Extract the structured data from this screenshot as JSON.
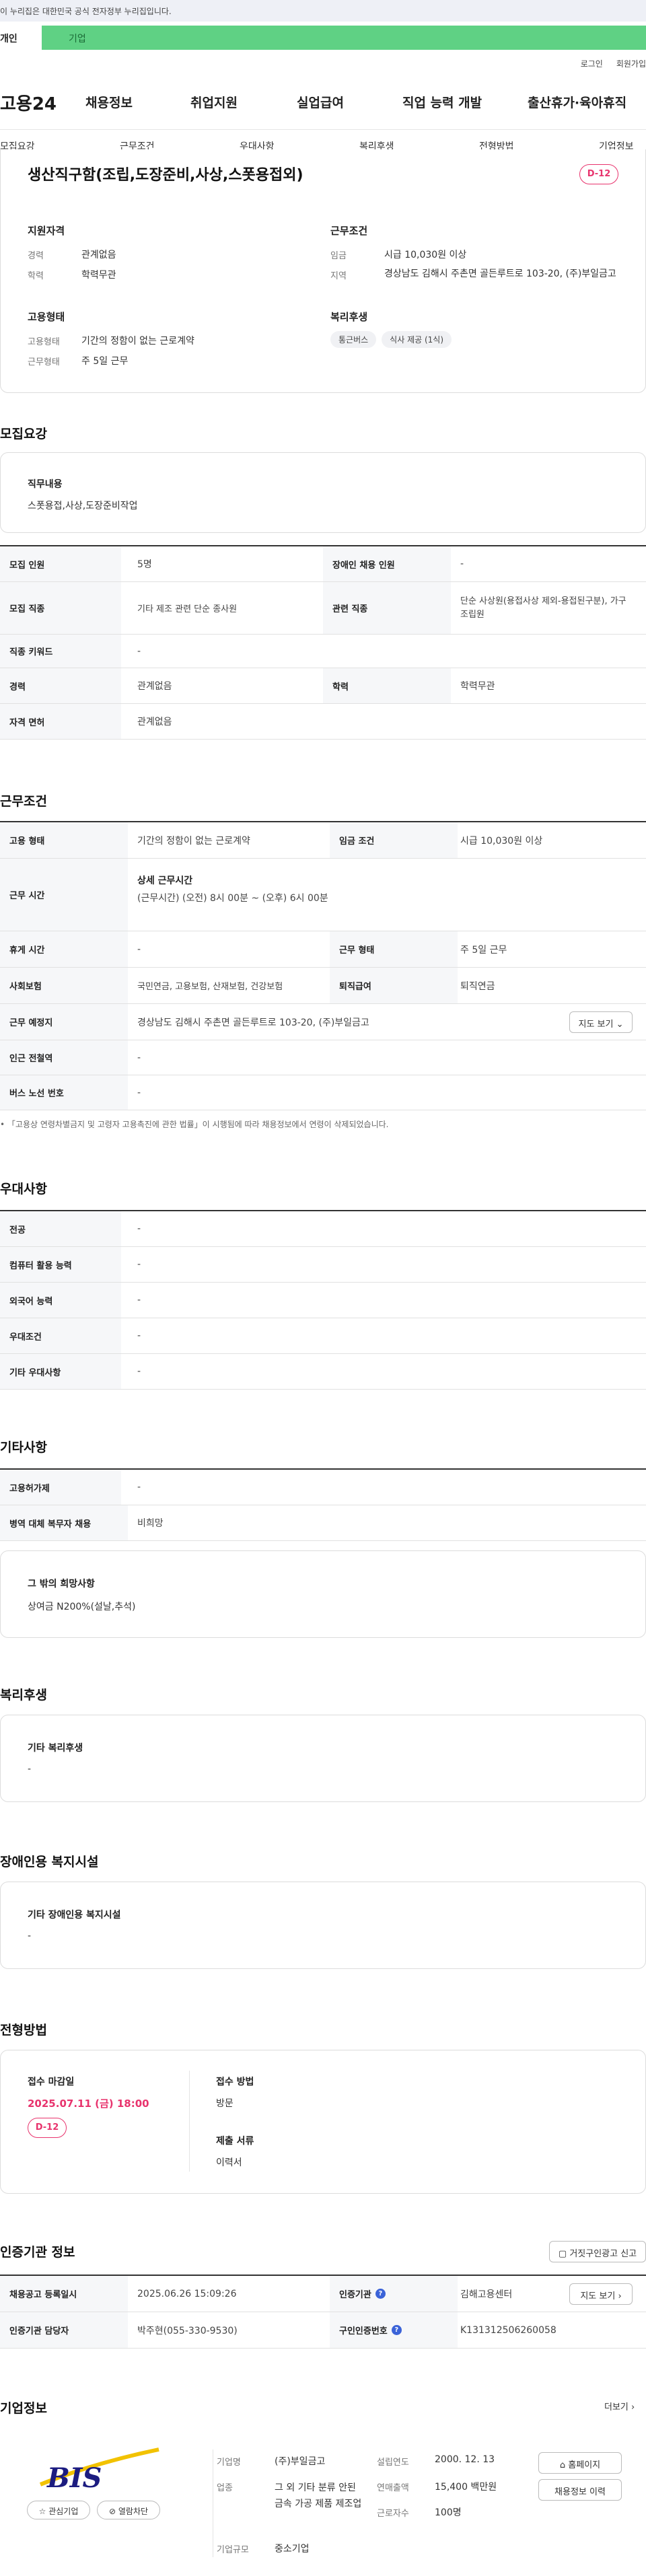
{
  "gov_banner": "이 누리집은 대한민국 공식 전자정부 누리집입니다.",
  "user_tabs": {
    "personal": "개인",
    "company": "기업"
  },
  "top_links": {
    "login": "로그인",
    "signup": "회원가입"
  },
  "logo": "고용24",
  "main_nav": [
    "채용정보",
    "취업지원",
    "실업급여",
    "직업 능력 개발",
    "출산휴가·육아휴직"
  ],
  "sub_nav": [
    "모집요강",
    "근무조건",
    "우대사항",
    "복리후생",
    "전형방법",
    "기업정보"
  ],
  "job": {
    "title": "생산직구함(조립,도장준비,사상,스폿용접외)",
    "dday": "D-12",
    "qualification_title": "지원자격",
    "qualification": [
      {
        "k": "경력",
        "v": "관계없음"
      },
      {
        "k": "학력",
        "v": "학력무관"
      }
    ],
    "conditions_title": "근무조건",
    "conditions": [
      {
        "k": "임금",
        "v": "시급 10,030원 이상"
      },
      {
        "k": "지역",
        "v": "경상남도 김해시 주촌면 골든루트로 103-20, (주)부일금고"
      }
    ],
    "employment_title": "고용형태",
    "employment": [
      {
        "k": "고용형태",
        "v": "기간의 정함이 없는 근로계약"
      },
      {
        "k": "근무형태",
        "v": "주 5일 근무"
      }
    ],
    "welfare_title": "복리후생",
    "welfare_chips": [
      "통근버스",
      "식사 제공 (1식)"
    ]
  },
  "recruit": {
    "title": "모집요강",
    "duty_label": "직무내용",
    "duty": "스폿용접,사상,도장준비작업",
    "rows": [
      {
        "k1": "모집 인원",
        "v1": "5명",
        "k2": "장애인 채용 인원",
        "v2": "-"
      },
      {
        "k1": "모집 직종",
        "v1": "기타 제조 관련 단순 종사원",
        "k2": "관련 직종",
        "v2": "단순 사상원(용접사상 제외-용접된구분), 가구 조립원"
      },
      {
        "k1": "직종 키워드",
        "v1": "-"
      },
      {
        "k1": "경력",
        "v1": "관계없음",
        "k2": "학력",
        "v2": "학력무관"
      },
      {
        "k1": "자격 면허",
        "v1": "관계없음"
      }
    ]
  },
  "work": {
    "title": "근무조건",
    "row1": {
      "k1": "고용 형태",
      "v1": "기간의 정함이 없는 근로계약",
      "k2": "임금 조건",
      "v2": "시급 10,030원 이상"
    },
    "hours_label": "근무 시간",
    "hours_title": "상세 근무시간",
    "hours_detail": "(근무시간) (오전) 8시 00분 ~ (오후) 6시 00분",
    "row3": {
      "k1": "휴게 시간",
      "v1": "-",
      "k2": "근무 형태",
      "v2": "주 5일 근무"
    },
    "row4": {
      "k1": "사회보험",
      "v1": "국민연금, 고용보험, 산재보험, 건강보험",
      "k2": "퇴직급여",
      "v2": "퇴직연금"
    },
    "location_label": "근무 예정지",
    "location": "경상남도 김해시 주촌면 골든루트로 103-20, (주)부일금고",
    "map_button": "지도 보기",
    "station_label": "인근 전철역",
    "station": "-",
    "bus_label": "버스 노선 번호",
    "bus": "-",
    "note": "「고용상 연령차별금지 및 고령자 고용촉진에 관한 법률」이 시행됨에 따라 채용정보에서 연령이 삭제되었습니다."
  },
  "preference": {
    "title": "우대사항",
    "rows": [
      {
        "k": "전공",
        "v": "-"
      },
      {
        "k": "컴퓨터 활용 능력",
        "v": "-"
      },
      {
        "k": "외국어 능력",
        "v": "-"
      },
      {
        "k": "우대조건",
        "v": "-"
      },
      {
        "k": "기타 우대사항",
        "v": "-"
      }
    ]
  },
  "other": {
    "title": "기타사항",
    "rows": [
      {
        "k": "고용허가제",
        "v": "-"
      },
      {
        "k": "병역 대체 복무자 채용",
        "v": "비희망"
      }
    ],
    "wish_label": "그 밖의 희망사항",
    "wish": "상여금 N200%(설날,추석)"
  },
  "benefits": {
    "title": "복리후생",
    "label": "기타 복리후생",
    "value": "-"
  },
  "disability": {
    "title": "장애인용 복지시설",
    "label": "기타 장애인용 복지시설",
    "value": "-"
  },
  "selection": {
    "title": "전형방법",
    "deadline_label": "접수 마감일",
    "deadline": "2025.07.11 (금) 18:00",
    "dday": "D-12",
    "method_label": "접수 방법",
    "method": "방문",
    "docs_label": "제출 서류",
    "docs": "이력서"
  },
  "agency": {
    "title": "인증기관 정보",
    "report_button": "거짓구인광고 신고",
    "row1": {
      "k1": "채용공고 등록일시",
      "v1": "2025.06.26 15:09:26",
      "k2": "인증기관",
      "v2": "김해고용센터"
    },
    "row2": {
      "k1": "인증기관 담당자",
      "v1": "박주현(055-330-9530)",
      "k2": "구인인증번호",
      "v2": "K131312506260058"
    },
    "map_button": "지도 보기"
  },
  "company": {
    "title": "기업정보",
    "more": "더보기",
    "logo_text": "BIS",
    "interest_button": "관심기업",
    "block_button": "열람차단",
    "fields": [
      {
        "k": "기업명",
        "v": "(주)부일금고"
      },
      {
        "k": "업종",
        "v": "그 외 기타 분류 안된 금속 가공 제품 제조업"
      },
      {
        "k": "기업규모",
        "v": "중소기업"
      }
    ],
    "fields2": [
      {
        "k": "설립연도",
        "v": "2000. 12. 13"
      },
      {
        "k": "연매출액",
        "v": "15,400 백만원"
      },
      {
        "k": "근로자수",
        "v": "100명"
      }
    ],
    "homepage_button": "홈페이지",
    "history_button": "채용정보 이력"
  },
  "colors": {
    "accent_green": "#5fd184",
    "dday_pink": "#e8336d",
    "info_blue": "#3b63d8"
  }
}
